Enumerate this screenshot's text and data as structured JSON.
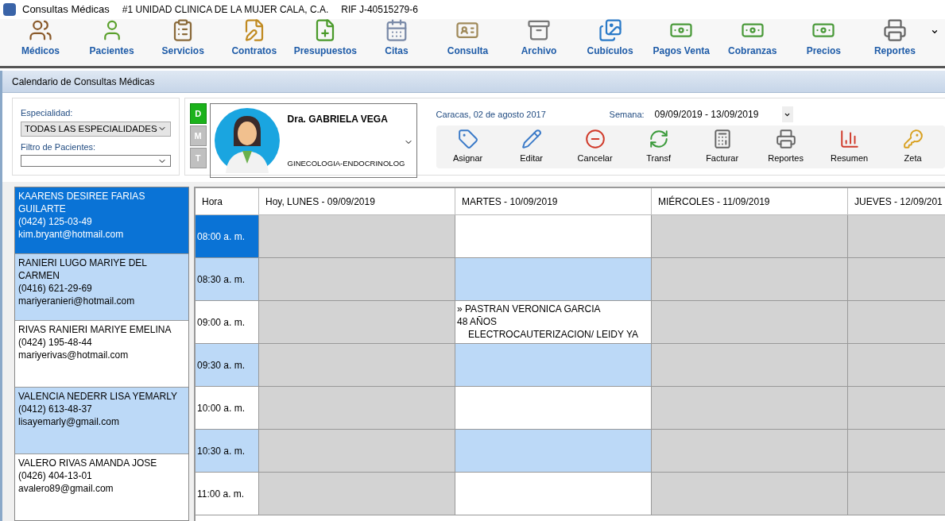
{
  "window": {
    "title": "Consultas Médicas",
    "clinic": "#1  UNIDAD CLINICA DE LA MUJER CALA, C.A.",
    "rif": "RIF J-40515279-6"
  },
  "toolbar": [
    "Médicos",
    "Pacientes",
    "Servicios",
    "Contratos",
    "Presupuestos",
    "Citas",
    "Consulta",
    "Archivo",
    "Cubículos",
    "Pagos Venta",
    "Cobranzas",
    "Precios",
    "Reportes"
  ],
  "panel": {
    "title": "Calendario de Consultas Médicas"
  },
  "filters": {
    "specialty_label": "Especialidad:",
    "specialty_value": "TODAS LAS ESPECIALIDADES",
    "patient_filter_label": "Filtro de Pacientes:"
  },
  "shifts": [
    {
      "label": "D",
      "selected": true
    },
    {
      "label": "M",
      "selected": false
    },
    {
      "label": "T",
      "selected": false
    }
  ],
  "doctor": {
    "name": "Dra. GABRIELA VEGA",
    "specialty": "GINECOLOGIA-ENDOCRINOLOG"
  },
  "date": "Caracas, 02 de agosto 2017",
  "week": {
    "label": "Semana:",
    "value": "09/09/2019 - 13/09/2019"
  },
  "actions": [
    "Asignar",
    "Editar",
    "Cancelar",
    "Transf",
    "Facturar",
    "Reportes",
    "Resumen",
    "Zeta"
  ],
  "patients": [
    {
      "name": "KAARENS DESIREE FARIAS GUILARTE",
      "phone": "(0424) 125-03-49",
      "email": "kim.bryant@hotmail.com",
      "selected": true
    },
    {
      "name": "RANIERI LUGO MARIYE DEL CARMEN",
      "phone": "(0416) 621-29-69",
      "email": "mariyeranieri@hotmail.com",
      "selected": false
    },
    {
      "name": "RIVAS RANIERI MARIYE EMELINA",
      "phone": "(0424) 195-48-44",
      "email": "mariyerivas@hotmail.com",
      "selected": false
    },
    {
      "name": "VALENCIA NEDERR LISA YEMARLY",
      "phone": "(0412) 613-48-37",
      "email": "lisayemarly@gmail.com",
      "selected": false
    },
    {
      "name": "VALERO RIVAS AMANDA JOSE",
      "phone": "(0426) 404-13-01",
      "email": "avalero89@gmail.com",
      "selected": false
    }
  ],
  "calendar": {
    "columns": [
      "Hora",
      "Hoy, LUNES - 09/09/2019",
      "MARTES - 10/09/2019",
      "MIÉRCOLES - 11/09/2019",
      "JUEVES - 12/09/201"
    ],
    "rows": [
      {
        "cells": [
          {
            "kind": "time",
            "text": "08:00 a. m.",
            "selected": true
          },
          {
            "kind": "blocked"
          },
          {
            "kind": "free"
          },
          {
            "kind": "blocked"
          },
          {
            "kind": "blocked"
          }
        ]
      },
      {
        "cells": [
          {
            "kind": "time",
            "text": "08:30 a. m.",
            "selected": false
          },
          {
            "kind": "blocked"
          },
          {
            "kind": "free"
          },
          {
            "kind": "blocked"
          },
          {
            "kind": "blocked"
          }
        ]
      },
      {
        "cells": [
          {
            "kind": "time",
            "text": "09:00 a. m.",
            "selected": false
          },
          {
            "kind": "blocked"
          },
          {
            "kind": "appointment",
            "patient": "» PASTRAN VERONICA GARCIA",
            "age": "48 AÑOS",
            "service": "ELECTROCAUTERIZACION/ LEIDY YA"
          },
          {
            "kind": "blocked"
          },
          {
            "kind": "blocked"
          }
        ]
      },
      {
        "cells": [
          {
            "kind": "time",
            "text": "09:30 a. m.",
            "selected": false
          },
          {
            "kind": "blocked"
          },
          {
            "kind": "free"
          },
          {
            "kind": "blocked"
          },
          {
            "kind": "blocked"
          }
        ]
      },
      {
        "cells": [
          {
            "kind": "time",
            "text": "10:00 a. m.",
            "selected": false
          },
          {
            "kind": "blocked"
          },
          {
            "kind": "free"
          },
          {
            "kind": "blocked"
          },
          {
            "kind": "blocked"
          }
        ]
      },
      {
        "cells": [
          {
            "kind": "time",
            "text": "10:30 a. m.",
            "selected": false
          },
          {
            "kind": "blocked"
          },
          {
            "kind": "free"
          },
          {
            "kind": "blocked"
          },
          {
            "kind": "blocked"
          }
        ]
      },
      {
        "cells": [
          {
            "kind": "time",
            "text": "11:00 a. m.",
            "selected": false
          },
          {
            "kind": "blocked"
          },
          {
            "kind": "free"
          },
          {
            "kind": "blocked"
          },
          {
            "kind": "blocked"
          }
        ]
      }
    ]
  }
}
